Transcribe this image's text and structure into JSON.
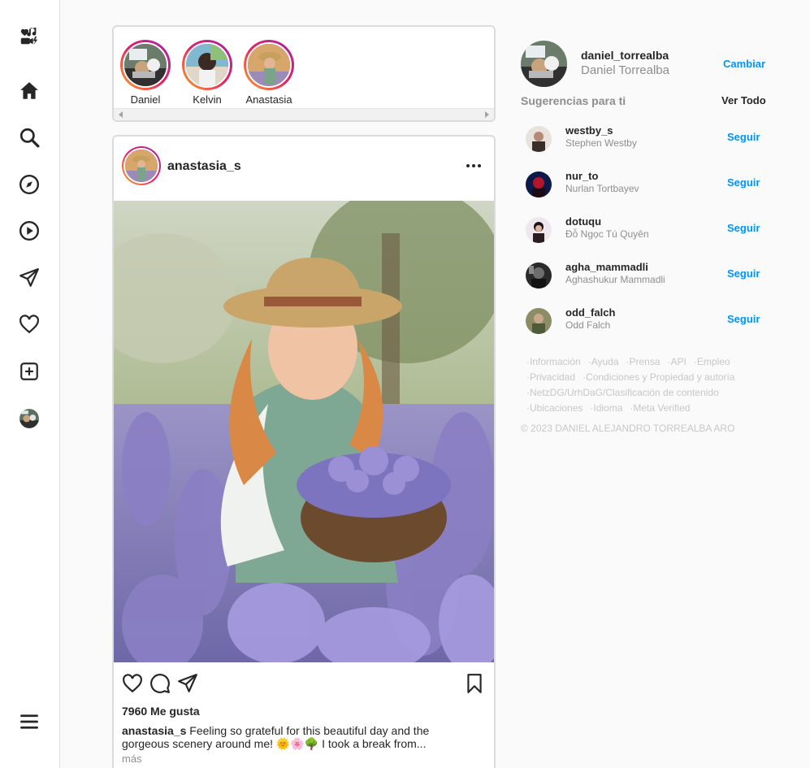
{
  "stories": [
    {
      "name": "Daniel"
    },
    {
      "name": "Kelvin"
    },
    {
      "name": "Anastasia"
    }
  ],
  "post": {
    "username": "anastasia_s",
    "likes": "7960 Me gusta",
    "caption_user": "anastasia_s",
    "caption_text": " Feeling so grateful for this beautiful day and the gorgeous scenery around me! 🌞🌸🌳 I took a break from...",
    "more": "más"
  },
  "me": {
    "username": "daniel_torrealba",
    "name": "Daniel Torrealba",
    "switch": "Cambiar"
  },
  "suggestions": {
    "title": "Sugerencias para ti",
    "see_all": "Ver Todo",
    "items": [
      {
        "username": "westby_s",
        "name": "Stephen Westby",
        "action": "Seguir"
      },
      {
        "username": "nur_to",
        "name": "Nurlan Tortbayev",
        "action": "Seguir"
      },
      {
        "username": "dotuqu",
        "name": "Đỗ Ngọc Tú Quyên",
        "action": "Seguir"
      },
      {
        "username": "agha_mammadli",
        "name": "Aghashukur Mammadli",
        "action": "Seguir"
      },
      {
        "username": "odd_falch",
        "name": "Odd Falch",
        "action": "Seguir"
      }
    ]
  },
  "footer": {
    "rows": [
      [
        "·Información",
        "·Ayuda",
        "·Prensa",
        "·API",
        "·Empleo"
      ],
      [
        "·Privacidad",
        "·Condiciones y Propiedad y autoría"
      ],
      [
        "·NetzDG/UrhDaG/Clasificación de contenido"
      ],
      [
        "·Ubicaciones",
        "·Idioma",
        "·Meta Verified"
      ]
    ],
    "copyright": "© 2023 DANIEL ALEJANDRO TORREALBA ARO"
  },
  "colors": {
    "accent": "#0095f6",
    "story_ring": [
      "#f9a825",
      "#e91e63",
      "#9c27b0"
    ]
  },
  "icons": {
    "sidebar": [
      "logo-icon",
      "home-icon",
      "search-icon",
      "explore-icon",
      "reels-icon",
      "messages-icon",
      "notifications-icon",
      "create-icon",
      "profile-avatar",
      "menu-icon"
    ],
    "post_actions": [
      "heart-icon",
      "comment-icon",
      "share-icon",
      "bookmark-icon"
    ]
  }
}
